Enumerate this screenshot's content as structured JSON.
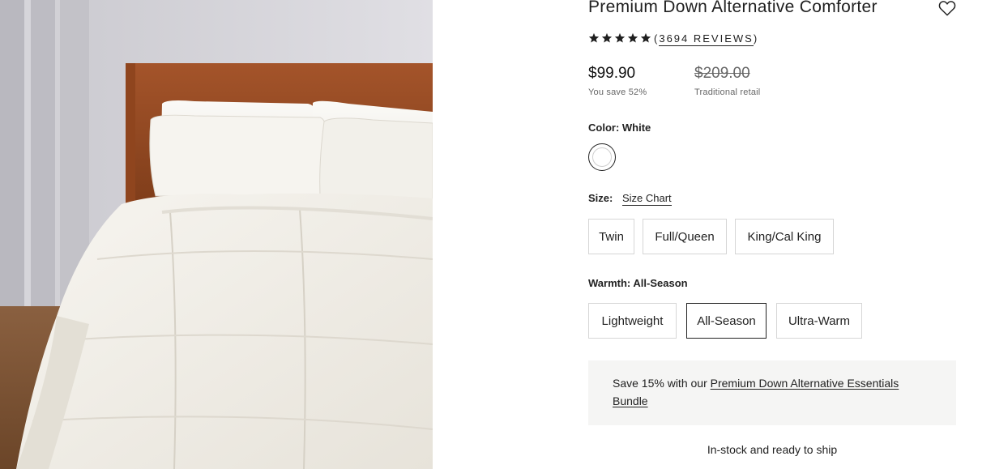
{
  "product": {
    "title": "Premium Down Alternative Comforter",
    "wishlist_icon": "heart-outline-icon",
    "image_alt": "White quilted comforter on a wooden bed with white pillows",
    "rating": {
      "stars": 5,
      "reviews_open": "(",
      "reviews_count": "3694 REVIEWS",
      "reviews_close": ")"
    },
    "price": {
      "current": "$99.90",
      "savings_note": "You save 52%",
      "original": "$209.00",
      "original_note": "Traditional retail"
    },
    "color": {
      "label": "Color:",
      "selected": "White",
      "swatch_color": "#ffffff"
    },
    "size": {
      "label": "Size:",
      "chart_link": "Size Chart",
      "options": [
        "Twin",
        "Full/Queen",
        "King/Cal King"
      ]
    },
    "warmth": {
      "label": "Warmth:",
      "selected": "All-Season",
      "options": [
        "Lightweight",
        "All-Season",
        "Ultra-Warm"
      ]
    },
    "promo": {
      "prefix": "Save 15% with our ",
      "link_text": "Premium Down Alternative Essentials Bundle"
    },
    "stock": "In-stock and ready to ship"
  }
}
